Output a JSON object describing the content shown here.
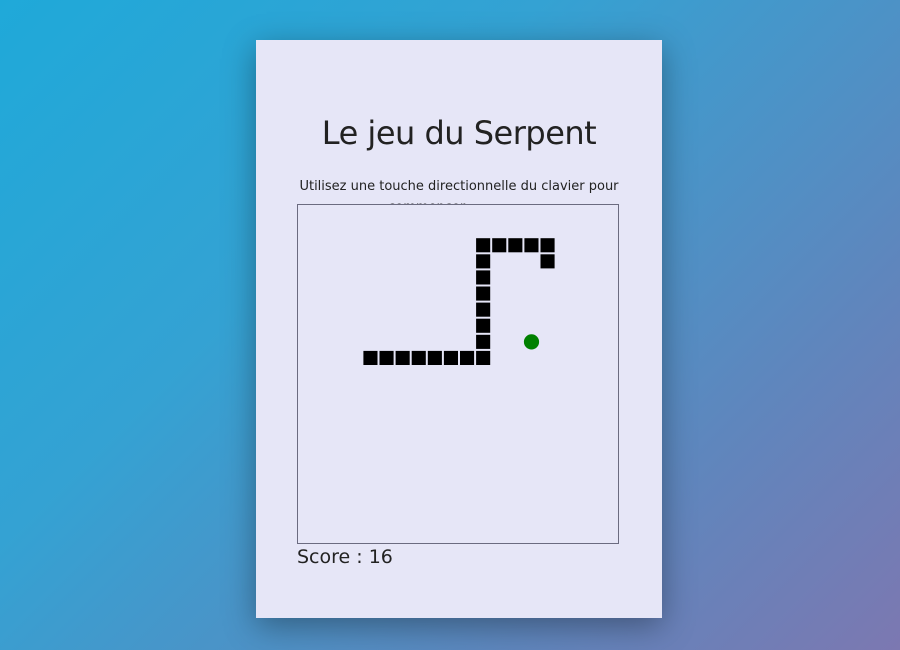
{
  "game": {
    "title": "Le jeu du Serpent",
    "instructions": "Utilisez une touche directionnelle du clavier pour commencer :",
    "arrow_icons": [
      "arrow-up-icon",
      "arrow-down-icon",
      "arrow-left-icon",
      "arrow-right-icon"
    ],
    "score_label": "Score : 16"
  },
  "board": {
    "cols": 20,
    "rows": 21,
    "snake": [
      [
        4,
        9
      ],
      [
        5,
        9
      ],
      [
        6,
        9
      ],
      [
        7,
        9
      ],
      [
        8,
        9
      ],
      [
        9,
        9
      ],
      [
        10,
        9
      ],
      [
        11,
        9
      ],
      [
        11,
        8
      ],
      [
        11,
        7
      ],
      [
        11,
        6
      ],
      [
        11,
        5
      ],
      [
        11,
        4
      ],
      [
        11,
        3
      ],
      [
        11,
        2
      ],
      [
        12,
        2
      ],
      [
        13,
        2
      ],
      [
        14,
        2
      ],
      [
        15,
        2
      ],
      [
        15,
        3
      ]
    ],
    "food": [
      14,
      8
    ],
    "colors": {
      "snake": "#000000",
      "food": "#008000",
      "background": "#e6e6f7"
    }
  }
}
